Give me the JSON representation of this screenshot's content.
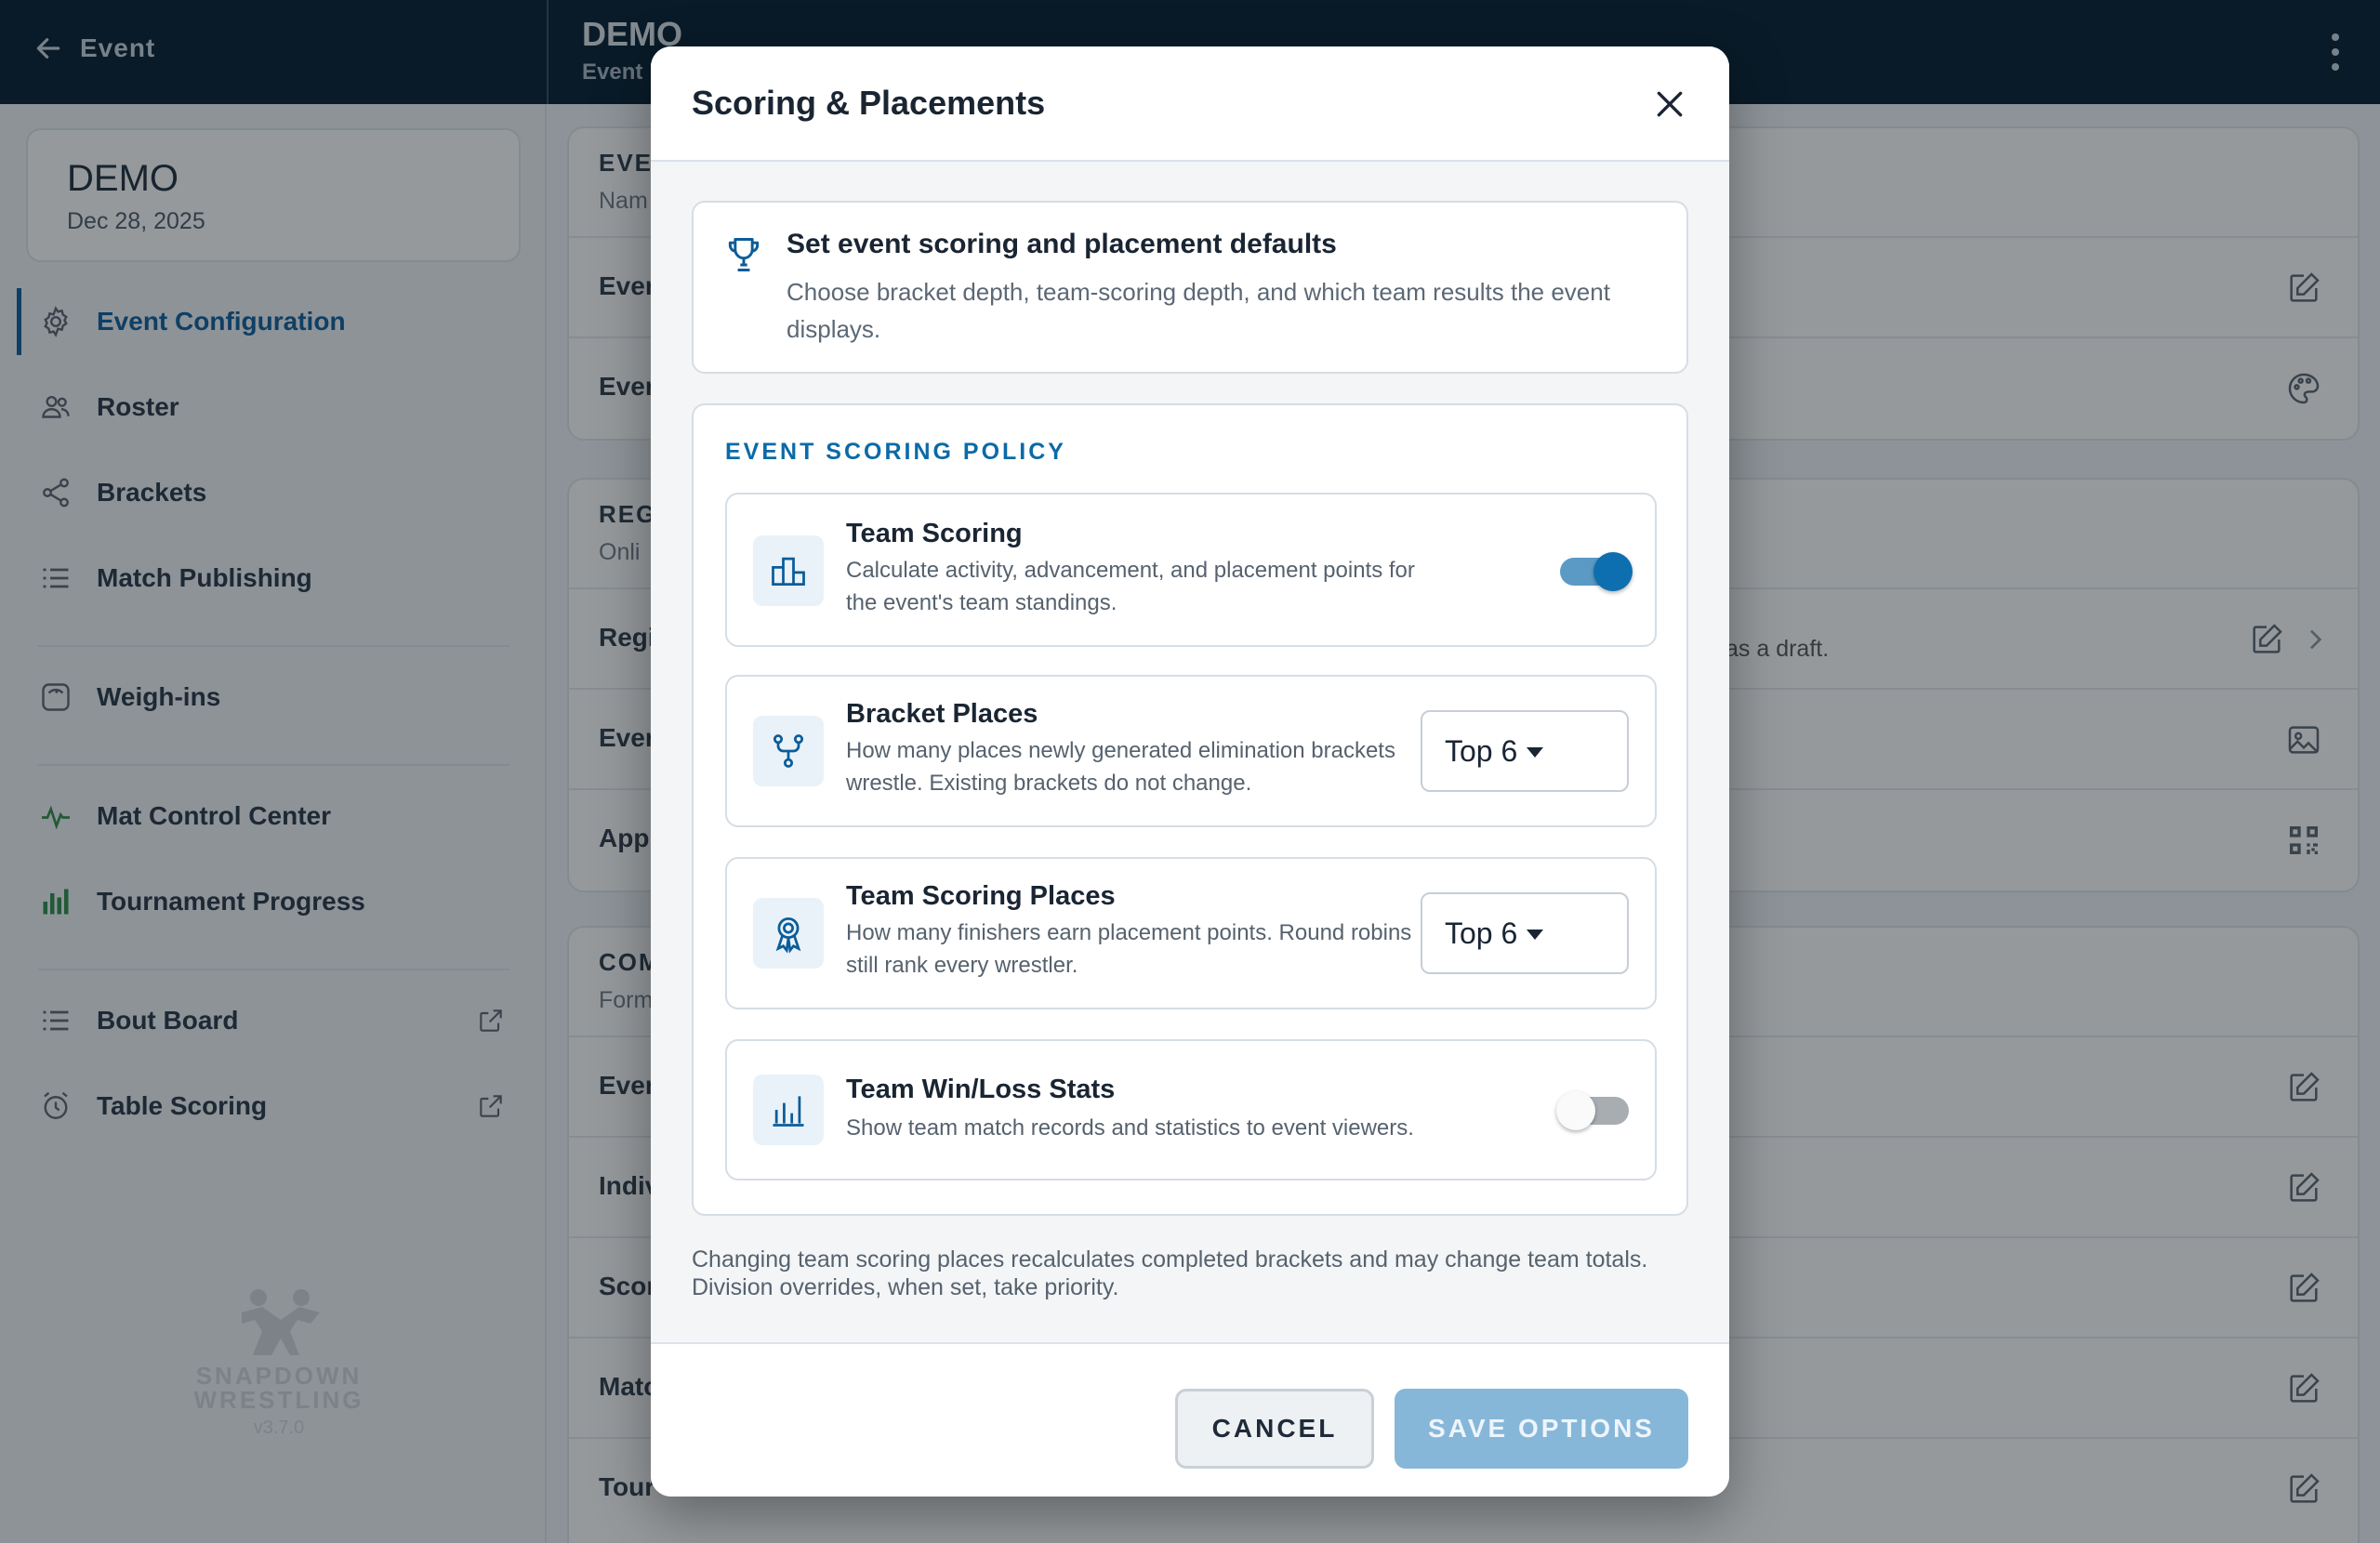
{
  "topbar": {
    "back_label": "Event",
    "title": "DEMO",
    "subtitle": "Event"
  },
  "sidebar": {
    "event_name": "DEMO",
    "event_date": "Dec 28, 2025",
    "items": [
      {
        "label": "Event Configuration",
        "icon": "gear-icon",
        "active": true
      },
      {
        "label": "Roster",
        "icon": "people-icon"
      },
      {
        "label": "Brackets",
        "icon": "share-icon"
      },
      {
        "label": "Match Publishing",
        "icon": "list-icon"
      },
      {
        "label": "Weigh-ins",
        "icon": "scale-icon"
      },
      {
        "label": "Mat Control Center",
        "icon": "pulse-icon"
      },
      {
        "label": "Tournament Progress",
        "icon": "bar-chart-icon"
      },
      {
        "label": "Bout Board",
        "icon": "list-icon"
      },
      {
        "label": "Table Scoring",
        "icon": "alarm-icon"
      }
    ],
    "logo_line1": "SNAPDOWN",
    "logo_line2": "WRESTLING",
    "version": "v3.7.0"
  },
  "background": {
    "panel1": {
      "header": "EVE",
      "sub": "Nam",
      "rows": [
        "Ever",
        "Ever"
      ]
    },
    "panel2": {
      "header": "REG",
      "sub": "Onli",
      "rows": [
        "Regi",
        "Ever",
        "App"
      ],
      "draft_text": "as a draft."
    },
    "panel3": {
      "header": "COM",
      "sub": "Form",
      "rows": [
        "Ever",
        "Indiv",
        "Scor",
        "Matc",
        "Tour"
      ]
    }
  },
  "modal": {
    "title": "Scoring & Placements",
    "intro_heading": "Set event scoring and placement defaults",
    "intro_text": "Choose bracket depth, team-scoring depth, and which team results the event displays.",
    "section_heading": "EVENT SCORING POLICY",
    "options": {
      "team_scoring": {
        "title": "Team Scoring",
        "desc": "Calculate activity, advancement, and placement points for the event's team standings.",
        "enabled": true
      },
      "bracket_places": {
        "title": "Bracket Places",
        "desc": "How many places newly generated elimination brackets wrestle. Existing brackets do not change.",
        "value": "Top 6"
      },
      "team_scoring_places": {
        "title": "Team Scoring Places",
        "desc": "How many finishers earn placement points. Round robins still rank every wrestler.",
        "value": "Top 6"
      },
      "team_win_loss": {
        "title": "Team Win/Loss Stats",
        "desc": "Show team match records and statistics to event viewers.",
        "enabled": false
      }
    },
    "note": "Changing team scoring places recalculates completed brackets and may change team totals. Division overrides, when set, take priority.",
    "cancel_label": "CANCEL",
    "save_label": "SAVE OPTIONS"
  }
}
